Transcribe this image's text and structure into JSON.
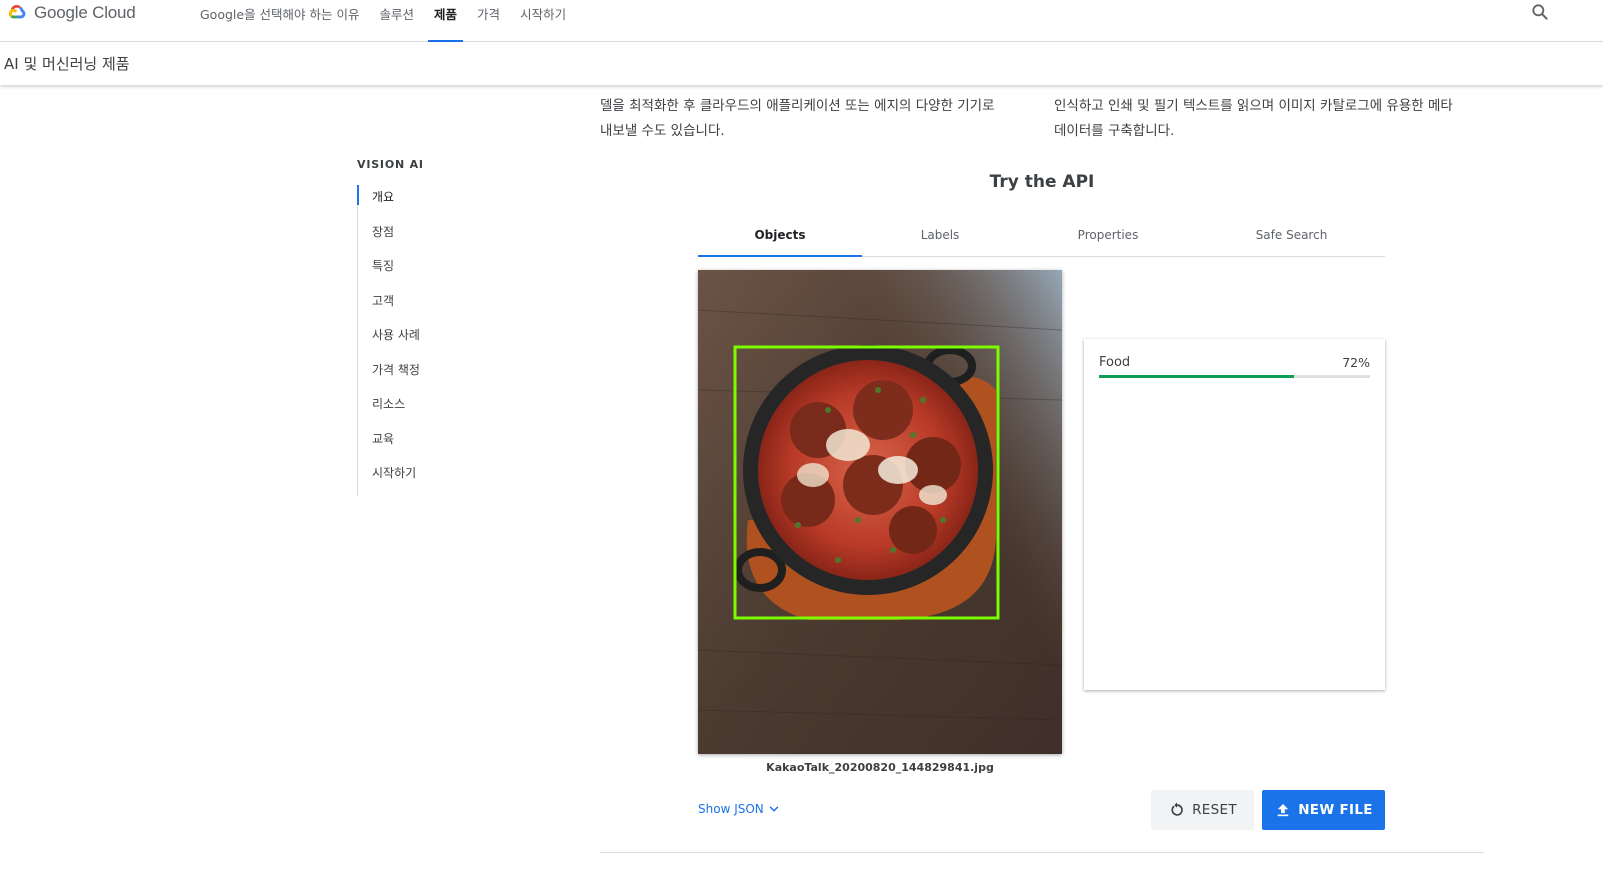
{
  "header": {
    "logo_text": "Google Cloud",
    "nav": [
      {
        "label": "Google을 선택해야 하는 이유",
        "active": false
      },
      {
        "label": "솔루션",
        "active": false
      },
      {
        "label": "제품",
        "active": true
      },
      {
        "label": "가격",
        "active": false
      },
      {
        "label": "시작하기",
        "active": false
      }
    ]
  },
  "subheader": {
    "title": "AI 및 머신러닝 제품"
  },
  "intro": {
    "left_lines": [
      "델을 최적화한 후 클라우드의 애플리케이션 또는 에지의 다양한 기기로",
      "내보낼 수도 있습니다."
    ],
    "right_lines": [
      "인식하고 인쇄 및 필기 텍스트를 읽으며 이미지 카탈로그에 유용한 메타",
      "데이터를 구축합니다."
    ]
  },
  "sidenav": {
    "heading": "VISION AI",
    "items": [
      {
        "label": "개요",
        "active": true
      },
      {
        "label": "장점",
        "active": false
      },
      {
        "label": "특징",
        "active": false
      },
      {
        "label": "고객",
        "active": false
      },
      {
        "label": "사용 사례",
        "active": false
      },
      {
        "label": "가격 책정",
        "active": false
      },
      {
        "label": "리소스",
        "active": false
      },
      {
        "label": "교육",
        "active": false
      },
      {
        "label": "시작하기",
        "active": false
      }
    ]
  },
  "api": {
    "title": "Try the API",
    "tabs": [
      {
        "label": "Objects",
        "active": true
      },
      {
        "label": "Labels",
        "active": false
      },
      {
        "label": "Properties",
        "active": false
      },
      {
        "label": "Safe Search",
        "active": false
      }
    ],
    "file_name": "KakaoTalk_20200820_144829841.jpg",
    "results": [
      {
        "label": "Food",
        "score_text": "72%",
        "score": 0.72
      }
    ],
    "show_json": "Show JSON",
    "reset_label": "RESET",
    "new_file_label": "NEW FILE"
  },
  "colors": {
    "accent": "#1a73e8",
    "score_bar": "#0f9d58",
    "bbox": "#7cfc00"
  }
}
